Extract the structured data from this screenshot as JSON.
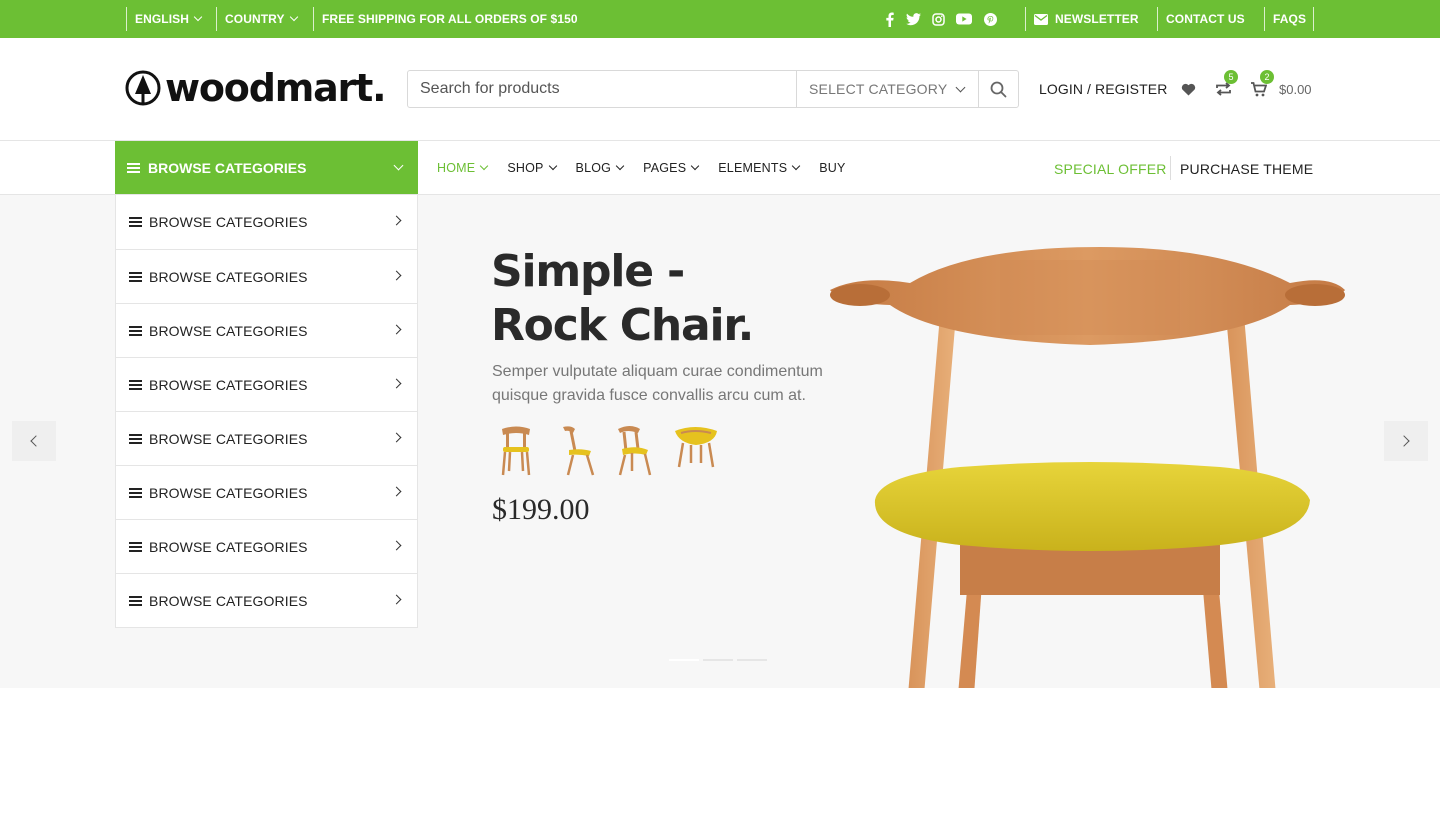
{
  "colors": {
    "brand_green": "#6cbf34",
    "hero_bg": "#f7f7f7"
  },
  "topbar": {
    "language": "ENGLISH",
    "country": "COUNTRY",
    "shipping": "FREE SHIPPING FOR ALL ORDERS OF $150",
    "social_icons": [
      "facebook-icon",
      "twitter-icon",
      "instagram-icon",
      "youtube-icon",
      "pinterest-icon"
    ],
    "newsletter": "NEWSLETTER",
    "contact": "CONTACT US",
    "faqs": "FAQS"
  },
  "header": {
    "logo_text": "woodmart.",
    "search": {
      "placeholder": "Search for products",
      "category": "SELECT CATEGORY"
    },
    "login": "LOGIN / REGISTER",
    "compare_count": "5",
    "cart_count": "2",
    "cart_total": "$0.00"
  },
  "nav": {
    "browse": "BROWSE CATEGORIES",
    "menu": [
      {
        "label": "HOME",
        "dropdown": true
      },
      {
        "label": "SHOP",
        "dropdown": true
      },
      {
        "label": "BLOG",
        "dropdown": true
      },
      {
        "label": "PAGES",
        "dropdown": true
      },
      {
        "label": "ELEMENTS",
        "dropdown": true
      },
      {
        "label": "BUY",
        "dropdown": false
      }
    ],
    "special_offer": "SPECIAL OFFER",
    "purchase": "PURCHASE THEME"
  },
  "categories": [
    "BROWSE CATEGORIES",
    "BROWSE CATEGORIES",
    "BROWSE CATEGORIES",
    "BROWSE CATEGORIES",
    "BROWSE CATEGORIES",
    "BROWSE CATEGORIES",
    "BROWSE CATEGORIES",
    "BROWSE CATEGORIES"
  ],
  "hero": {
    "title_line1": "Simple -",
    "title_line2": "Rock Chair.",
    "description": "Semper vulputate aliquam curae condimentum quisque gravida fusce convallis arcu cum at.",
    "price": "$199.00",
    "thumbnails": [
      "chair-front-thumb",
      "chair-side-thumb",
      "chair-angle-thumb",
      "chair-yellow-thumb"
    ],
    "slide_count": 3,
    "active_slide": 1
  }
}
